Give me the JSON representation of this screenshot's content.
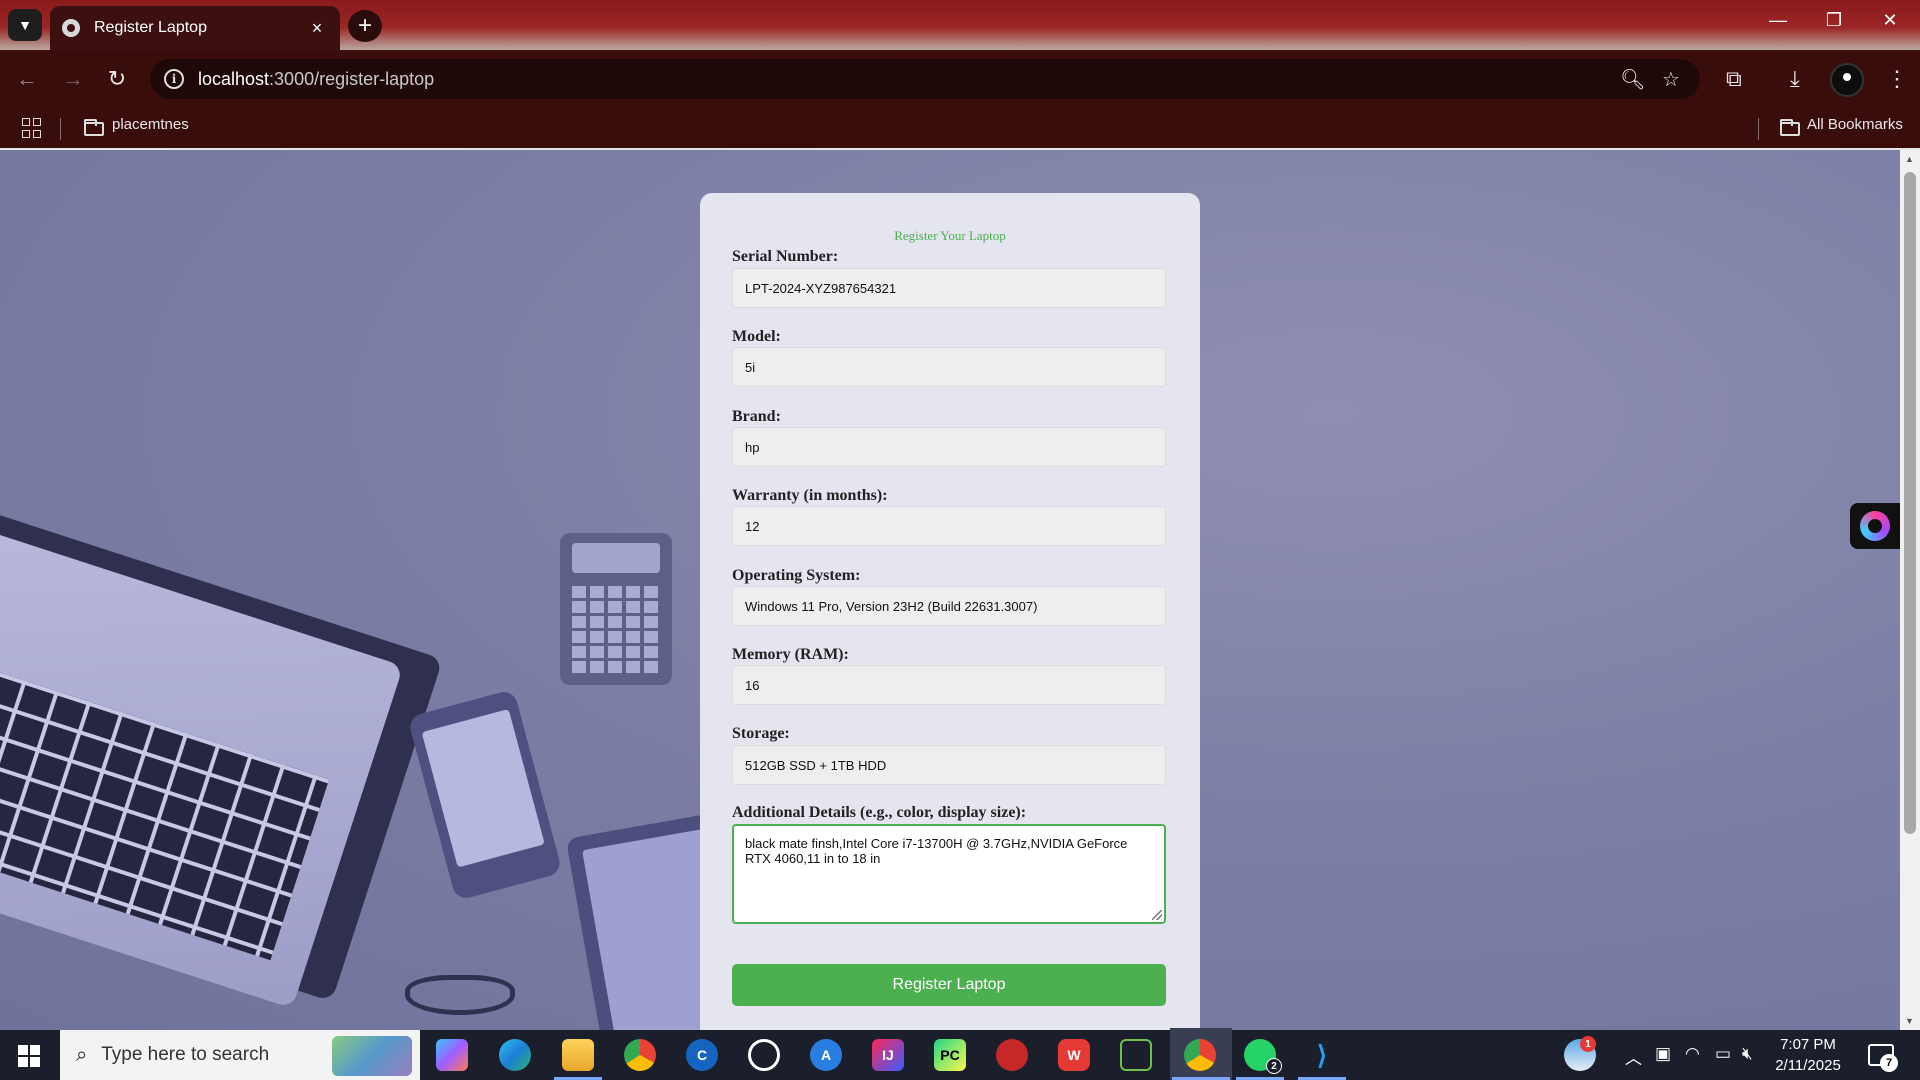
{
  "browser": {
    "tab_title": "Register Laptop",
    "tab_close": "×",
    "new_tab": "+",
    "url_host": "localhost",
    "url_path": ":3000/register-laptop",
    "bookmark_folder": "placemtnes",
    "all_bookmarks": "All Bookmarks",
    "window_controls": {
      "minimize": "—",
      "restore": "❐",
      "close": "✕"
    }
  },
  "form": {
    "title": "Register Your Laptop",
    "fields": [
      {
        "label": "Serial Number:",
        "value": "LPT-2024-XYZ987654321"
      },
      {
        "label": "Model:",
        "value": "5i"
      },
      {
        "label": "Brand:",
        "value": "hp"
      },
      {
        "label": "Warranty (in months):",
        "value": "12"
      },
      {
        "label": "Operating System:",
        "value": "Windows 11 Pro, Version 23H2 (Build 22631.3007)"
      },
      {
        "label": "Memory (RAM):",
        "value": "16"
      },
      {
        "label": "Storage:",
        "value": "512GB SSD + 1TB HDD"
      }
    ],
    "details_label": "Additional Details (e.g., color, display size):",
    "details_value": "black mate finsh,Intel Core i7-13700H @ 3.7GHz,NVIDIA GeForce RTX 4060,11 in to 18 in",
    "submit_label": "Register Laptop",
    "accent_color": "#4caf50"
  },
  "taskbar": {
    "search_placeholder": "Type here to search",
    "apps": [
      "copilot",
      "edge",
      "file-explorer",
      "chrome",
      "ccleaner",
      "github",
      "app-store",
      "intellij",
      "pycharm",
      "game-app",
      "wps-office",
      "visual-studio",
      "chrome-active",
      "whatsapp",
      "vscode"
    ],
    "whatsapp_badge": "2",
    "weather_badge": "1",
    "time": "7:07 PM",
    "date": "2/11/2025",
    "notification_count": "7"
  }
}
